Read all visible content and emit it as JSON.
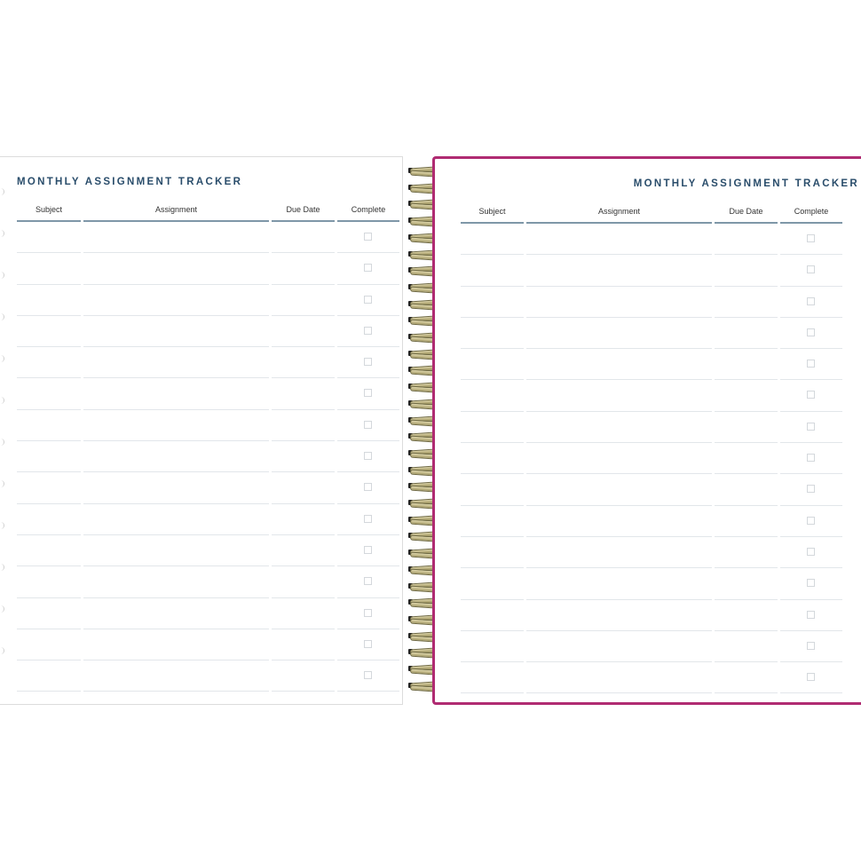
{
  "left_page": {
    "title": "MONTHLY ASSIGNMENT TRACKER",
    "columns": {
      "subject": "Subject",
      "assignment": "Assignment",
      "due_date": "Due Date",
      "complete": "Complete"
    }
  },
  "right_page": {
    "title": "MONTHLY ASSIGNMENT TRACKER",
    "columns": {
      "subject": "Subject",
      "assignment": "Assignment",
      "due_date": "Due Date",
      "complete": "Complete"
    }
  },
  "rows_per_page": 15,
  "colors": {
    "title": "#2a4d6b",
    "cover": "#b02b72",
    "header_rule": "#7f97a8",
    "coil": "#c9bf8a"
  }
}
